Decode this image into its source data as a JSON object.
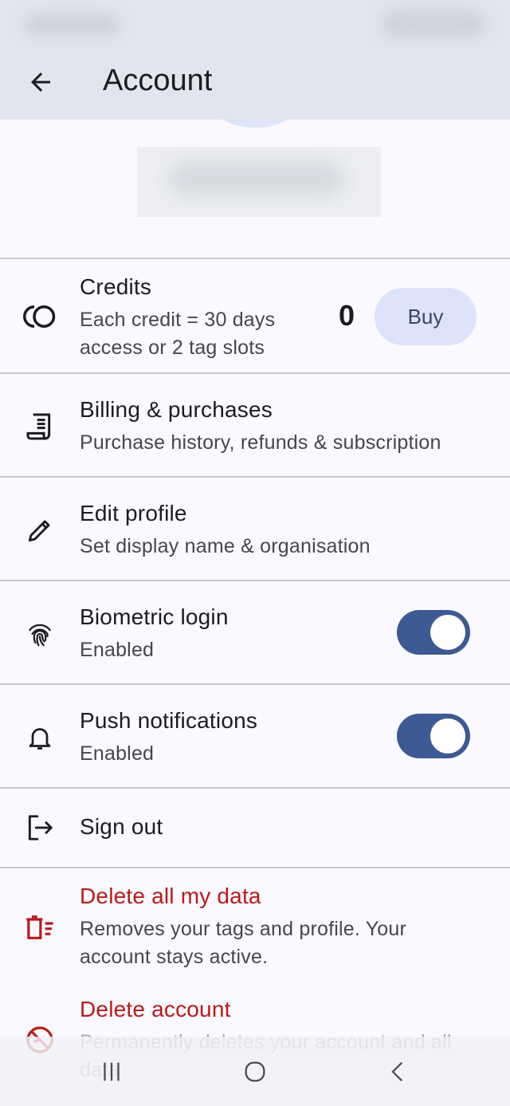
{
  "app_bar": {
    "title": "Account"
  },
  "credits": {
    "title": "Credits",
    "subtitle_line1": "Each credit = 30 days",
    "subtitle_line2": "access or 2 tag slots",
    "count": "0",
    "buy_label": "Buy"
  },
  "billing": {
    "title": "Billing & purchases",
    "subtitle": "Purchase history, refunds & subscription"
  },
  "edit_profile": {
    "title": "Edit profile",
    "subtitle": "Set display name & organisation"
  },
  "biometric": {
    "title": "Biometric login",
    "subtitle": "Enabled",
    "enabled": true
  },
  "push": {
    "title": "Push notifications",
    "subtitle": "Enabled",
    "enabled": true
  },
  "sign_out": {
    "title": "Sign out"
  },
  "delete_data": {
    "title": "Delete all my data",
    "subtitle_line1": "Removes your tags and profile. Your",
    "subtitle_line2": "account stays active."
  },
  "delete_account": {
    "title": "Delete account",
    "subtitle_line1": "Permanently deletes your account and all",
    "subtitle_line2": "data"
  },
  "colors": {
    "accent": "#3e5a94",
    "danger": "#ba1a1a",
    "app_bar": "#e2e5ef",
    "background": "#f9f9ff"
  },
  "icons": [
    "arrow-back",
    "credits",
    "receipt",
    "pencil",
    "fingerprint",
    "bell",
    "logout",
    "delete-sweep",
    "no-account",
    "recent-apps",
    "home",
    "nav-back"
  ]
}
